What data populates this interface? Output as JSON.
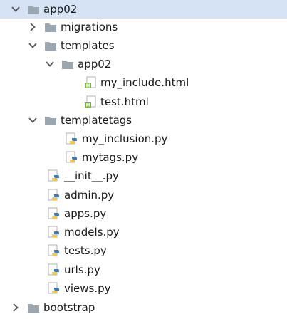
{
  "tree": {
    "root": {
      "label": "app02",
      "expanded": true
    },
    "migrations": {
      "label": "migrations",
      "expanded": false
    },
    "templates": {
      "label": "templates",
      "expanded": true
    },
    "templates_app02": {
      "label": "app02",
      "expanded": true
    },
    "my_include_html": {
      "label": "my_include.html",
      "icon": "html-file-icon"
    },
    "test_html": {
      "label": "test.html",
      "icon": "html-file-icon"
    },
    "templatetags": {
      "label": "templatetags",
      "expanded": true
    },
    "my_inclusion_py": {
      "label": "my_inclusion.py",
      "icon": "python-file-icon"
    },
    "mytags_py": {
      "label": "mytags.py",
      "icon": "python-file-icon"
    },
    "init_py": {
      "label": "__init__.py",
      "icon": "python-file-icon"
    },
    "admin_py": {
      "label": "admin.py",
      "icon": "python-file-icon"
    },
    "apps_py": {
      "label": "apps.py",
      "icon": "python-file-icon"
    },
    "models_py": {
      "label": "models.py",
      "icon": "python-file-icon"
    },
    "tests_py": {
      "label": "tests.py",
      "icon": "python-file-icon"
    },
    "urls_py": {
      "label": "urls.py",
      "icon": "python-file-icon"
    },
    "views_py": {
      "label": "views.py",
      "icon": "python-file-icon"
    },
    "bootstrap": {
      "label": "bootstrap",
      "expanded": false
    }
  },
  "colors": {
    "selection": "#d5e3f5",
    "folder": "#9aa7b0",
    "html_icon": "#7cb342",
    "python_blue": "#3d7ab8",
    "python_yellow": "#f2c94c",
    "chevron": "#555555"
  }
}
